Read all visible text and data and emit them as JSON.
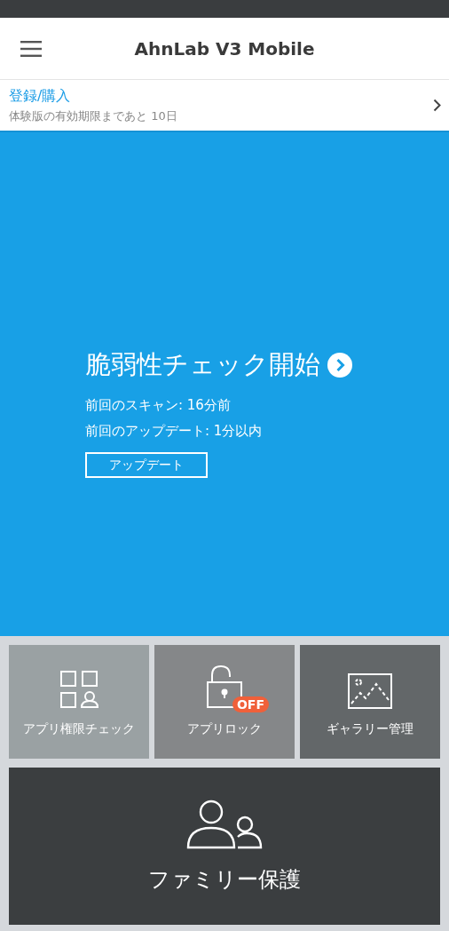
{
  "header": {
    "title": "AhnLab V3 Mobile"
  },
  "license_banner": {
    "link": "登録/購入",
    "note": "体験版の有効期限まであと 10日"
  },
  "scan_panel": {
    "title": "脆弱性チェック開始",
    "last_scan": "前回のスキャン: 16分前",
    "last_update": "前回のアップデート: 1分以内",
    "update_button": "アップデート"
  },
  "tiles": [
    {
      "kind": "permissions",
      "label": "アプリ権限チェック",
      "color": "#9aa1a3"
    },
    {
      "kind": "lock",
      "label": "アプリロック",
      "badge": "OFF",
      "color": "#858789"
    },
    {
      "kind": "gallery",
      "label": "ギャラリー管理",
      "color": "#636769"
    }
  ],
  "family_tile": {
    "label": "ファミリー保護"
  }
}
